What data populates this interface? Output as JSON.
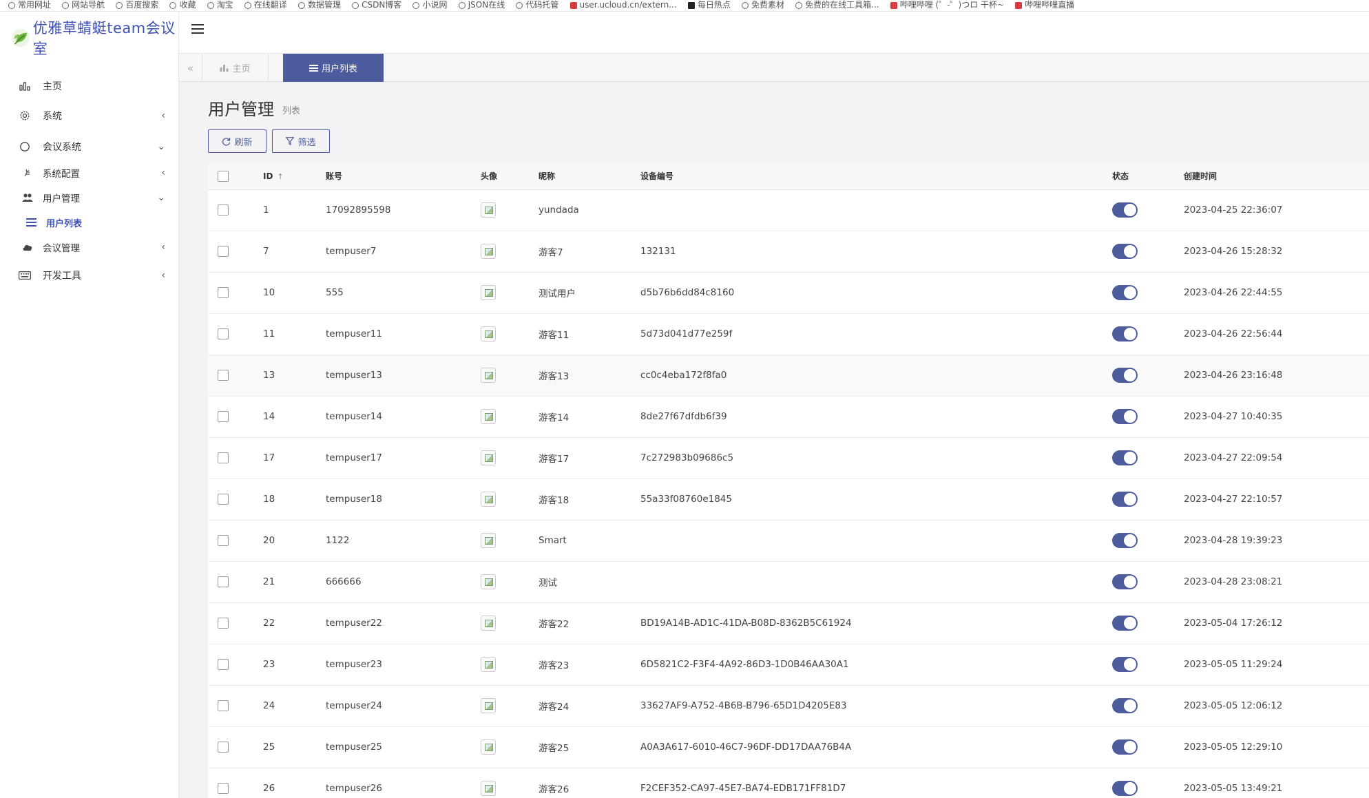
{
  "bookmarks": [
    "常用网址",
    "网站导航",
    "百度搜索",
    "收藏",
    "淘宝",
    "在线翻译",
    "数据管理",
    "CSDN博客",
    "小说网",
    "JSON在线",
    "代码托管",
    "user.ucloud.cn/extern...",
    "每日热点",
    "免费素材",
    "免费的在线工具箱...",
    "哔哩哔哩 (゜-゜)つロ 干杯~",
    "哔哩哔哩直播"
  ],
  "sidebar": {
    "logo_text": "优雅草蜻蜓team会议室",
    "items": [
      {
        "label": "主页"
      },
      {
        "label": "系统"
      },
      {
        "label": "会议系统"
      },
      {
        "label": "系统配置"
      },
      {
        "label": "用户管理"
      },
      {
        "label": "用户列表"
      },
      {
        "label": "会议管理"
      },
      {
        "label": "开发工具"
      }
    ]
  },
  "tabs": [
    {
      "label": "主页"
    },
    {
      "label": "用户列表"
    }
  ],
  "page": {
    "title": "用户管理",
    "subtitle": "列表",
    "refresh_label": "刷新",
    "filter_label": "筛选"
  },
  "table": {
    "headers": {
      "id": "ID",
      "account": "账号",
      "avatar": "头像",
      "nickname": "昵称",
      "device": "设备编号",
      "status": "状态",
      "created": "创建时间"
    },
    "rows": [
      {
        "id": "1",
        "account": "17092895598",
        "nickname": "yundada",
        "device": "",
        "created": "2023-04-25 22:36:07"
      },
      {
        "id": "7",
        "account": "tempuser7",
        "nickname": "游客7",
        "device": "132131",
        "created": "2023-04-26 15:28:32"
      },
      {
        "id": "10",
        "account": "555",
        "nickname": "测试用户",
        "device": "d5b76b6dd84c8160",
        "created": "2023-04-26 22:44:55"
      },
      {
        "id": "11",
        "account": "tempuser11",
        "nickname": "游客11",
        "device": "5d73d041d77e259f",
        "created": "2023-04-26 22:56:44"
      },
      {
        "id": "13",
        "account": "tempuser13",
        "nickname": "游客13",
        "device": "cc0c4eba172f8fa0",
        "created": "2023-04-26 23:16:48"
      },
      {
        "id": "14",
        "account": "tempuser14",
        "nickname": "游客14",
        "device": "8de27f67dfdb6f39",
        "created": "2023-04-27 10:40:35"
      },
      {
        "id": "17",
        "account": "tempuser17",
        "nickname": "游客17",
        "device": "7c272983b09686c5",
        "created": "2023-04-27 22:09:54"
      },
      {
        "id": "18",
        "account": "tempuser18",
        "nickname": "游客18",
        "device": "55a33f08760e1845",
        "created": "2023-04-27 22:10:57"
      },
      {
        "id": "20",
        "account": "1122",
        "nickname": "Smart",
        "device": "",
        "created": "2023-04-28 19:39:23"
      },
      {
        "id": "21",
        "account": "666666",
        "nickname": "测试",
        "device": "",
        "created": "2023-04-28 23:08:21"
      },
      {
        "id": "22",
        "account": "tempuser22",
        "nickname": "游客22",
        "device": "BD19A14B-AD1C-41DA-B08D-8362B5C61924",
        "created": "2023-05-04 17:26:12"
      },
      {
        "id": "23",
        "account": "tempuser23",
        "nickname": "游客23",
        "device": "6D5821C2-F3F4-4A92-86D3-1D0B46AA30A1",
        "created": "2023-05-05 11:29:24"
      },
      {
        "id": "24",
        "account": "tempuser24",
        "nickname": "游客24",
        "device": "33627AF9-A752-4B6B-B796-65D1D4205E83",
        "created": "2023-05-05 12:06:12"
      },
      {
        "id": "25",
        "account": "tempuser25",
        "nickname": "游客25",
        "device": "A0A3A617-6010-46C7-96DF-DD17DAA76B4A",
        "created": "2023-05-05 12:29:10"
      },
      {
        "id": "26",
        "account": "tempuser26",
        "nickname": "游客26",
        "device": "F2CEF352-CA97-45E7-BA74-EDB171FF81D7",
        "created": "2023-05-05 13:49:21"
      }
    ]
  },
  "colors": {
    "accent": "#4d5c9c",
    "logo": "#3f51b5"
  }
}
